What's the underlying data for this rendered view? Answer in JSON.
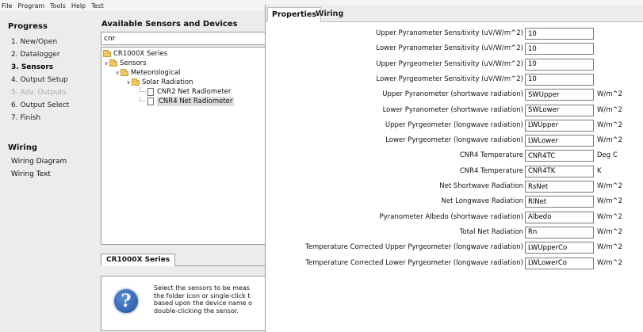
{
  "menu": [
    "File",
    "Program",
    "Tools",
    "Help",
    "Test"
  ],
  "progress": {
    "heading": "Progress",
    "steps": [
      {
        "label": "1. New/Open",
        "state": "normal"
      },
      {
        "label": "2. Datalogger",
        "state": "normal"
      },
      {
        "label": "3. Sensors",
        "state": "active"
      },
      {
        "label": "4. Output Setup",
        "state": "normal"
      },
      {
        "label": "5. Adv. Outputs",
        "state": "disabled"
      },
      {
        "label": "6. Output Select",
        "state": "normal"
      },
      {
        "label": "7. Finish",
        "state": "normal"
      }
    ],
    "wiring_heading": "Wiring",
    "wiring_links": [
      "Wiring Diagram",
      "Wiring Text"
    ]
  },
  "sensors": {
    "title": "Available Sensors and Devices",
    "search_value": "cnr",
    "tree": [
      {
        "label": "CR1000X Series",
        "type": "folder"
      },
      {
        "label": "Sensors",
        "type": "folder"
      },
      {
        "label": "Meteorological",
        "type": "folder"
      },
      {
        "label": "Solar Radiation",
        "type": "folder"
      },
      {
        "label": "CNR2 Net Radiometer",
        "type": "sensor"
      },
      {
        "label": "CNR4 Net Radiometer",
        "type": "sensor"
      }
    ],
    "tab_label": "CR1000X Series",
    "help_lines": [
      "Select the sensors to be meas",
      "the folder icon or single-click t",
      "based upon the device name o",
      "double-clicking the sensor."
    ],
    "help_icon_glyph": "?"
  },
  "properties": {
    "tabs": [
      "Properties",
      "Wiring"
    ],
    "rows": [
      {
        "label": "Upper Pyranometer Sensitivity (uV/W/m^2)",
        "value": "10",
        "unit": ""
      },
      {
        "label": "Lower Pyranometer Sensitivity (uV/W/m^2)",
        "value": "10",
        "unit": ""
      },
      {
        "label": "Upper Pyrgeometer Sensitivity (uV/W/m^2)",
        "value": "10",
        "unit": ""
      },
      {
        "label": "Lower Pyrgeometer Sensitivity (uV/W/m^2)",
        "value": "10",
        "unit": ""
      },
      {
        "label": "Upper Pyranometer (shortwave radiation)",
        "value": "SWUpper",
        "unit": "W/m^2"
      },
      {
        "label": "Lower Pyranometer (shortwave radiation)",
        "value": "SWLower",
        "unit": "W/m^2"
      },
      {
        "label": "Upper Pyrgeometer (longwave radiation)",
        "value": "LWUpper",
        "unit": "W/m^2"
      },
      {
        "label": "Lower Pyrgeometer (longwave radiation)",
        "value": "LWLower",
        "unit": "W/m^2"
      },
      {
        "label": "CNR4 Temperature",
        "value": "CNR4TC",
        "unit": "Deg C"
      },
      {
        "label": "CNR4 Temperature",
        "value": "CNR4TK",
        "unit": "K"
      },
      {
        "label": "Net Shortwave Radiation",
        "value": "RsNet",
        "unit": "W/m^2"
      },
      {
        "label": "Net Longwave Radiation",
        "value": "RlNet",
        "unit": "W/m^2"
      },
      {
        "label": "Pyranometer Albedo (shortwave radiation)",
        "value": "Albedo",
        "unit": "W/m^2"
      },
      {
        "label": "Total Net Radiation",
        "value": "Rn",
        "unit": "W/m^2"
      },
      {
        "label": "Temperature Corrected Upper Pyrgeometer (longwave radiation)",
        "value": "LWUpperCo",
        "unit": "W/m^2"
      },
      {
        "label": "Temperature Corrected Lower Pyrgeometer (longwave radiation)",
        "value": "LWLowerCo",
        "unit": "W/m^2"
      }
    ]
  }
}
